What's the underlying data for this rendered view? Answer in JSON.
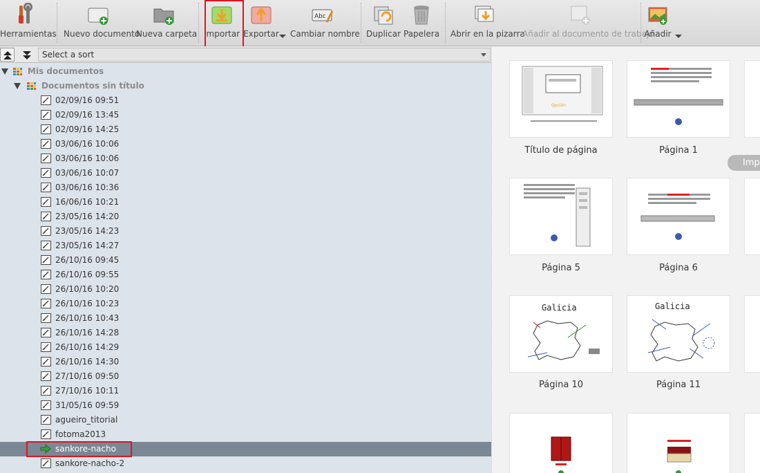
{
  "toolbar": {
    "buttons": [
      {
        "label": "Herramientas",
        "icon": "tools-icon"
      },
      {
        "label": "Nuevo documento",
        "icon": "new-document-icon"
      },
      {
        "label": "Nueva carpeta",
        "icon": "new-folder-icon"
      },
      {
        "label": "Importar",
        "icon": "import-icon"
      },
      {
        "label": "Exportar",
        "icon": "export-icon"
      },
      {
        "label": "Cambiar nombre",
        "icon": "rename-icon"
      },
      {
        "label": "Duplicar",
        "icon": "duplicate-icon"
      },
      {
        "label": "Papelera",
        "icon": "trash-icon"
      },
      {
        "label": "Abrir en la pizarra",
        "icon": "open-board-icon"
      },
      {
        "label": "Añadir al documento de trabajo",
        "icon": "add-to-document-icon",
        "disabled": true
      },
      {
        "label": "Añadir",
        "icon": "add-image-icon"
      }
    ]
  },
  "sort": {
    "placeholder": "Select a sort"
  },
  "tree": {
    "root": "Mis documentos",
    "folder": "Documentos sin título",
    "items": [
      "02/09/16 09:51",
      "02/09/16 13:45",
      "02/09/16 14:25",
      "03/06/16 10:06",
      "03/06/16 10:06",
      "03/06/16 10:07",
      "03/06/16 10:36",
      "16/06/16 10:21",
      "23/05/16 14:20",
      "23/05/16 14:23",
      "23/05/16 14:27",
      "26/10/16 09:45",
      "26/10/16 09:55",
      "26/10/16 10:20",
      "26/10/16 10:23",
      "26/10/16 10:43",
      "26/10/16 14:28",
      "26/10/16 14:29",
      "26/10/16 14:30",
      "27/10/16 09:50",
      "27/10/16 10:11",
      "31/05/16 09:59",
      "agueiro_titorial",
      "fotoma2013",
      "sankore-nacho",
      "sankore-nacho-2"
    ],
    "selected": "sankore-nacho"
  },
  "thumbnails": {
    "labels": [
      "Título de página",
      "Página 1",
      "Página 5",
      "Página 6",
      "Página 10",
      "Página 11"
    ],
    "galicia_text": "Galicia",
    "overlay_button": "Imp"
  },
  "colors": {
    "highlight": "#e0141c",
    "selected_row": "#7b8794",
    "tree_bg": "#dde3ea"
  }
}
